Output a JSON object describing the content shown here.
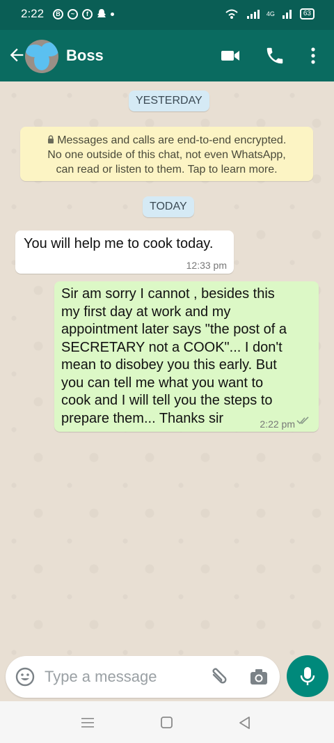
{
  "status_bar": {
    "time": "2:22",
    "network": "4G",
    "battery": "63"
  },
  "header": {
    "contact_name": "Boss",
    "icons": [
      "back-arrow-icon",
      "avatar",
      "video-call-icon",
      "phone-icon",
      "more-vert-icon"
    ]
  },
  "chat": {
    "date_chips": [
      "YESTERDAY",
      "TODAY"
    ],
    "encryption_notice": {
      "line1": "Messages and calls are end-to-end encrypted.",
      "line2": "No one outside of this chat, not even WhatsApp,",
      "line3": "can read or listen to them. Tap to learn more."
    },
    "messages": [
      {
        "direction": "incoming",
        "text": "You will help me to cook today.",
        "time": "12:33 pm"
      },
      {
        "direction": "outgoing",
        "lines": [
          "Sir am sorry  I cannot , besides this",
          "my first day at work and my",
          "appointment later says \"the post of a",
          "SECRETARY not a COOK\"... I don't",
          "mean to disobey you this early. But",
          "you can tell me what you want to",
          "cook and I will tell you the steps to",
          "prepare them... Thanks sir"
        ],
        "time": "2:22 pm",
        "status": "delivered"
      }
    ]
  },
  "composer": {
    "placeholder": "Type a message",
    "icons": [
      "emoji-icon",
      "attach-icon",
      "camera-icon",
      "mic-icon"
    ]
  },
  "colors": {
    "header": "#0a6b60",
    "status_bar": "#0a5e55",
    "incoming_bubble": "#ffffff",
    "outgoing_bubble": "#dcf8c6",
    "mic_button": "#00897b"
  }
}
